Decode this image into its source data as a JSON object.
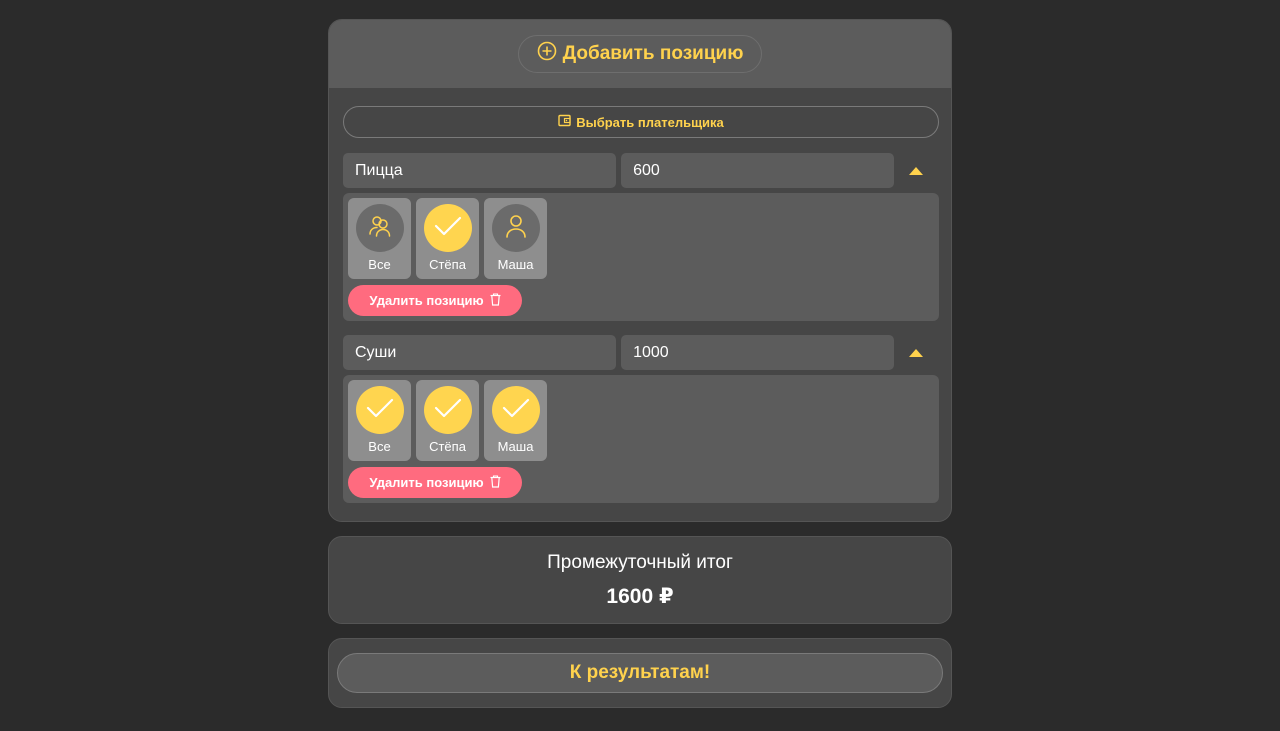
{
  "header": {
    "add_label": "Добавить позицию",
    "add_icon": "plus-circle-icon"
  },
  "payer": {
    "label": "Выбрать плательщика",
    "icon": "wallet-icon"
  },
  "positions": [
    {
      "name": "Пицца",
      "price": "600",
      "people": [
        {
          "name": "Все",
          "checked": false,
          "icon": "users-icon"
        },
        {
          "name": "Стёпа",
          "checked": true,
          "icon": "check-icon"
        },
        {
          "name": "Маша",
          "checked": false,
          "icon": "user-icon"
        }
      ],
      "delete_label": "Удалить позицию"
    },
    {
      "name": "Суши",
      "price": "1000",
      "people": [
        {
          "name": "Все",
          "checked": true,
          "icon": "check-icon"
        },
        {
          "name": "Стёпа",
          "checked": true,
          "icon": "check-icon"
        },
        {
          "name": "Маша",
          "checked": true,
          "icon": "check-icon"
        }
      ],
      "delete_label": "Удалить позицию"
    }
  ],
  "subtotal": {
    "label": "Промежуточный итог",
    "value": "1600 ₽"
  },
  "results": {
    "label": "К результатам!"
  },
  "colors": {
    "accent": "#ffd24d",
    "danger": "#ff6b7f",
    "background": "#2b2b2b",
    "card": "#464646"
  }
}
